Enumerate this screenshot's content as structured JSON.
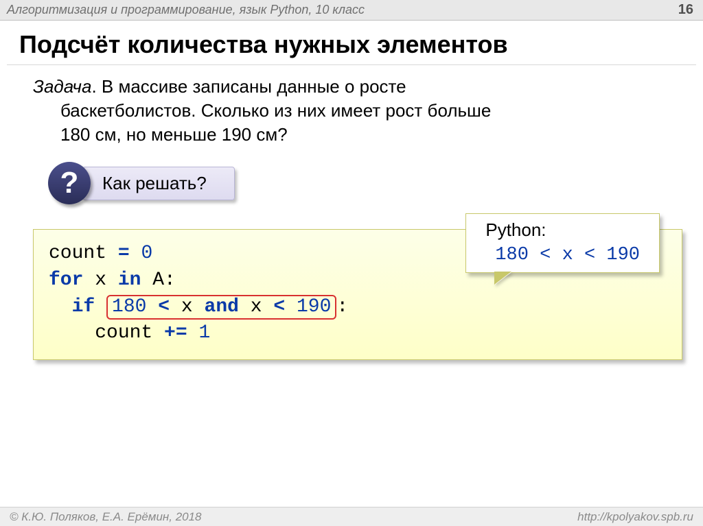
{
  "header": {
    "breadcrumb": "Алгоритмизация и программирование, язык Python, 10 класс",
    "page_number": "16"
  },
  "title": "Подсчёт количества нужных элементов",
  "task": {
    "label": "Задача",
    "line1": ". В массиве записаны данные о росте",
    "line2": "баскетболистов. Сколько из них имеет рост больше",
    "line3": "180 см, но меньше 190 см?"
  },
  "hint": {
    "icon": "?",
    "text": " Как решать?"
  },
  "code": {
    "l1a": "count",
    "l1b": "=",
    "l1c": "0",
    "l2a": "for",
    "l2b": " x ",
    "l2c": "in",
    "l2d": " A:",
    "l3a": "if",
    "l3_pre": "  ",
    "cond_a": "180",
    "cond_b": "<",
    "cond_c": "x",
    "cond_d": "and",
    "cond_e": "x",
    "cond_f": "<",
    "cond_g": "190",
    "l3_colon": ":",
    "l4a": "    count",
    "l4b": "+=",
    "l4c": "1"
  },
  "callout": {
    "label": "Python:",
    "expr": "180 < x < 190"
  },
  "footer": {
    "copyright": "© К.Ю. Поляков, Е.А. Ерёмин, 2018",
    "url": "http://kpolyakov.spb.ru"
  }
}
